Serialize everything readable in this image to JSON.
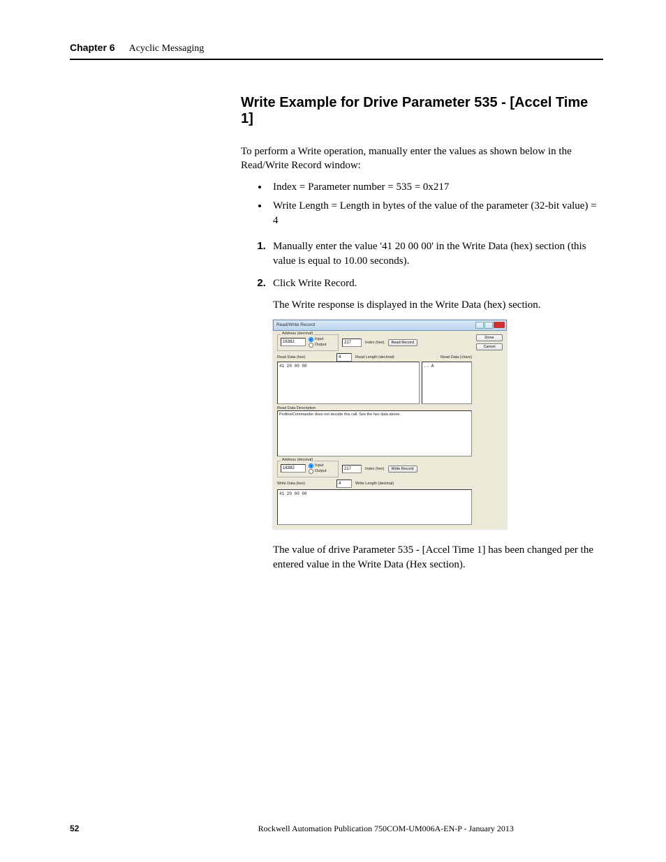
{
  "header": {
    "chapter": "Chapter 6",
    "title": "Acyclic Messaging"
  },
  "heading": "Write Example for Drive Parameter 535 - [Accel Time 1]",
  "intro": "To perform a Write operation, manually enter the values as shown below in the Read/Write Record window:",
  "bullets": [
    "Index = Parameter number = 535 = 0x217",
    "Write Length = Length in bytes of the value of the parameter (32-bit value) = 4"
  ],
  "steps": [
    "Manually enter the value '41 20 00 00' in the Write Data (hex) section (this value is equal to 10.00 seconds).",
    "Click Write Record."
  ],
  "step2_after": "The Write response is displayed in the Write Data (hex) section.",
  "closing": "The value of drive Parameter 535 - [Accel Time 1] has been changed per the entered value in the Write Data (Hex section).",
  "dialog": {
    "title": "Read/Write Record",
    "done": "Done",
    "cancel": "Cancel",
    "addr_legend": "Address (decimal)",
    "addr_value": "16382",
    "radio_input": "Input",
    "radio_output": "Output",
    "index_value": "217",
    "index_label": "Index (hex)",
    "read_record": "Read Record",
    "len_value": "4",
    "read_len_label": "Read Length (decimal)",
    "write_len_label": "Write Length (decimal)",
    "read_data_hex": "Read Data (hex)",
    "read_data_chars": "Read Data (chars)",
    "hex_content": "41 20 00 00",
    "chars_content": ".. A",
    "desc_label": "Read Data Description",
    "desc_text": "ProfinetCommander does not decode this call. See the hex data above.",
    "write_record": "Write Record",
    "write_data_hex": "Write Data (hex)"
  },
  "footer": {
    "page": "52",
    "pub": "Rockwell Automation Publication 750COM-UM006A-EN-P - January 2013"
  }
}
